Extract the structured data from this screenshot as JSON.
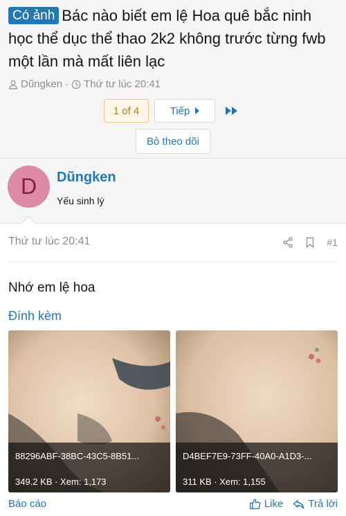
{
  "thread": {
    "prefix": "Có ảnh",
    "title": "Bác nào biết em lệ Hoa quê bắc ninh học thể dục thể thao 2k2 không trước từng fwb một lần mà mất liên lạc",
    "author": "Dũngken",
    "time": "Thứ tư lúc 20:41"
  },
  "pager": {
    "current": "1 of 4",
    "next": "Tiếp"
  },
  "unwatch_label": "Bỏ theo dõi",
  "user": {
    "initial": "D",
    "name": "Dũngken",
    "title": "Yếu sinh lý",
    "avatar_color": "#dd89a8"
  },
  "post": {
    "time": "Thứ tư lúc 20:41",
    "number": "#1",
    "message": "Nhớ em lệ hoa",
    "attachments_label": "Đính kèm",
    "attachments": [
      {
        "filename": "88296ABF-38BC-43C5-8B51...",
        "stats": "349.2 KB · Xem: 1,173"
      },
      {
        "filename": "D4BEF7E9-73FF-40A0-A1D3-...",
        "stats": "311 KB · Xem: 1,155"
      }
    ]
  },
  "footer": {
    "report": "Báo cáo",
    "like": "Like",
    "reply": "Trả lời"
  },
  "colors": {
    "accent": "#2577b1",
    "prefix_bg": "#2577b1",
    "page_current_bg": "#fef6e8"
  }
}
